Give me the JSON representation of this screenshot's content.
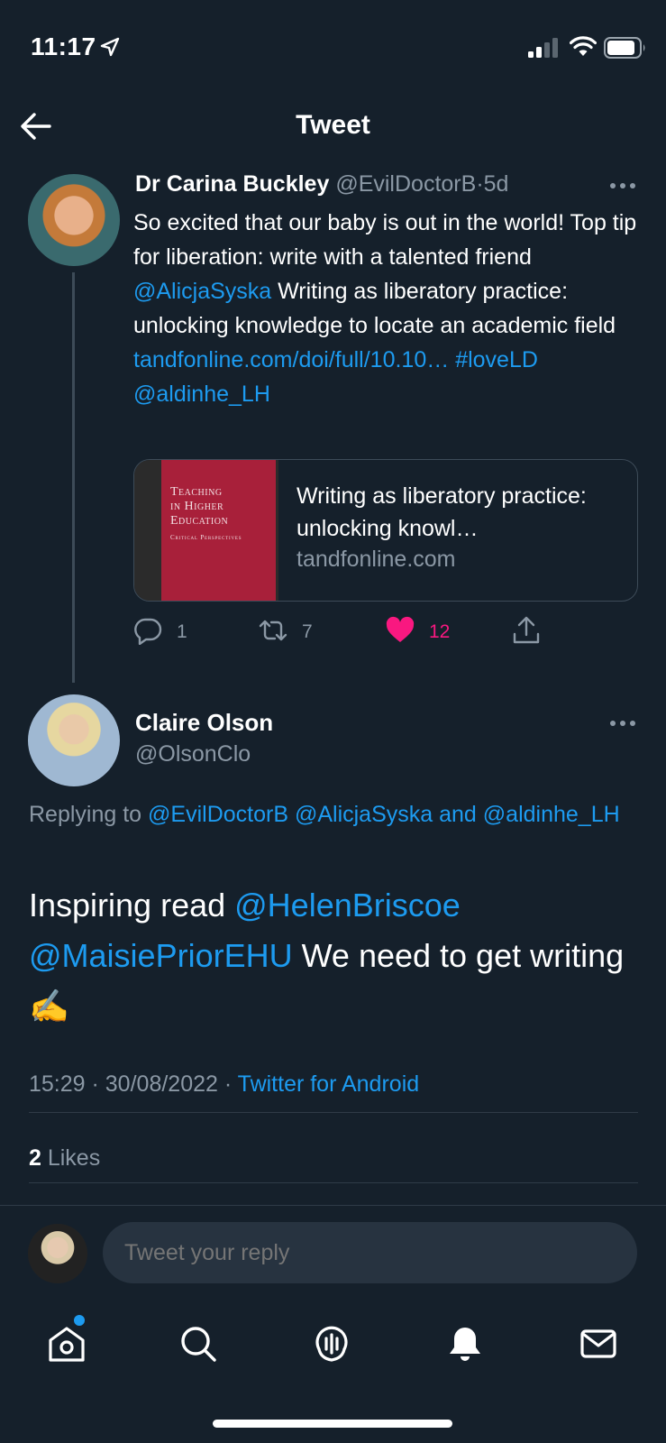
{
  "status_bar": {
    "time": "11:17"
  },
  "header": {
    "title": "Tweet"
  },
  "tweet": {
    "author_name": "Dr Carina Buckley",
    "author_handle": "@EvilDoctorB",
    "separator": "·",
    "age": "5d",
    "text_part1": "So excited that our baby is out in the world! Top tip for liberation: write with a talented friend ",
    "mention1": "@AlicjaSyska",
    "text_part2": "  Writing as liberatory practice: unlocking knowledge to locate an academic field ",
    "link": "tandfonline.com/doi/full/10.10…",
    "hashtag": "#loveLD",
    "mention2": "@aldinhe_LH",
    "card": {
      "cover_line1": "Teaching",
      "cover_line2": "in Higher",
      "cover_line3": "Education",
      "cover_sub": "Critical Perspectives",
      "title": "Writing as liberatory practice: unlocking knowl…",
      "domain": "tandfonline.com"
    },
    "actions": {
      "replies": "1",
      "retweets": "7",
      "likes": "12",
      "like_color": "#f91880"
    }
  },
  "reply": {
    "author_name": "Claire Olson",
    "author_handle": "@OlsonClo",
    "replying_prefix": "Replying to ",
    "replying_to1": "@EvilDoctorB",
    "replying_to2": "@AlicjaSyska",
    "replying_and": " and ",
    "replying_to3": "@aldinhe_LH",
    "text_part1": "Inspiring read ",
    "mention1": "@HelenBriscoe",
    "mention2": "@MaisiePriorEHU",
    "text_part2": " We need to get writing ✍️",
    "time": "15:29",
    "date": "30/08/2022",
    "source": "Twitter for Android",
    "likes_count": "2",
    "likes_label": " Likes"
  },
  "composer": {
    "placeholder": "Tweet your reply"
  },
  "tab_bar": {
    "items": [
      "home-icon",
      "search-icon",
      "spaces-icon",
      "notifications-icon",
      "messages-icon"
    ],
    "notification_dot_color": "#1d9bf0"
  },
  "colors": {
    "background": "#15202b",
    "accent": "#1d9bf0",
    "muted": "#8b98a5"
  }
}
